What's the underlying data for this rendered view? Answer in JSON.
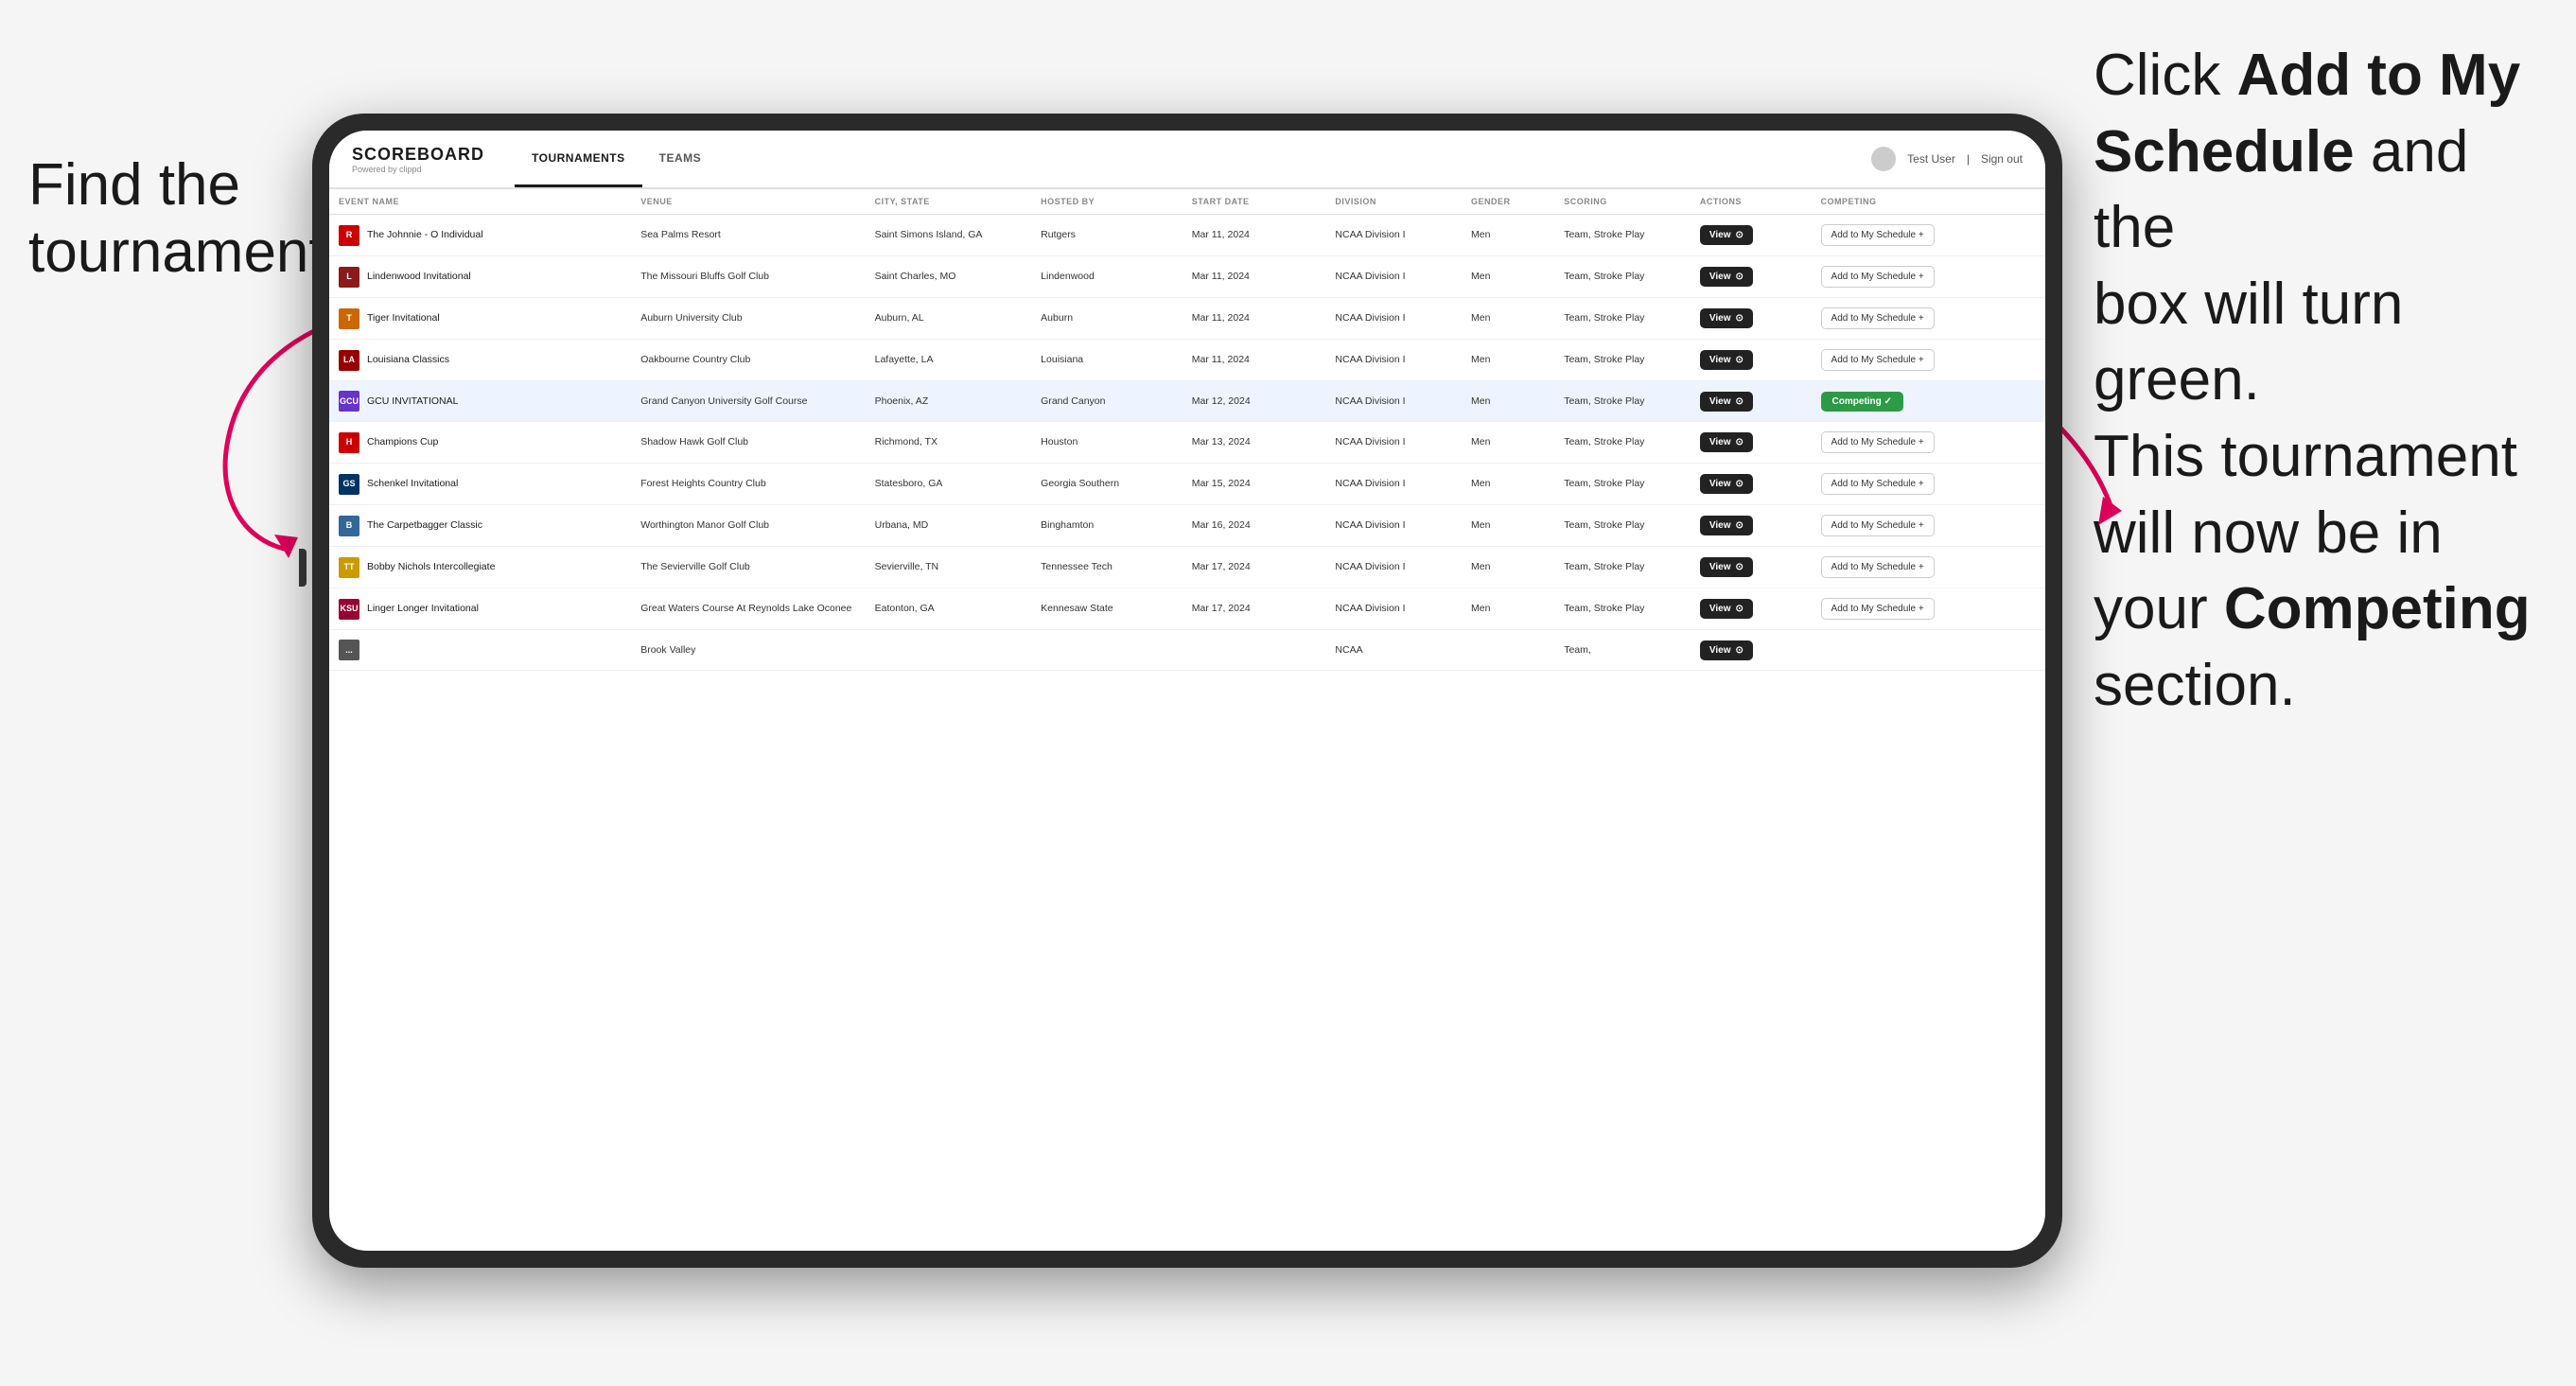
{
  "annotations": {
    "left": "Find the\ntournament.",
    "right_part1": "Click ",
    "right_bold1": "Add to My\nSchedule",
    "right_part2": " and the\nbox will turn green.\nThis tournament\nwill now be in\nyour ",
    "right_bold2": "Competing",
    "right_part3": "\nsection."
  },
  "nav": {
    "logo": "SCOREBOARD",
    "logo_sub": "Powered by clippd",
    "tabs": [
      "TOURNAMENTS",
      "TEAMS"
    ],
    "active_tab": "TOURNAMENTS",
    "user": "Test User",
    "signout": "Sign out"
  },
  "table": {
    "headers": [
      "EVENT NAME",
      "VENUE",
      "CITY, STATE",
      "HOSTED BY",
      "START DATE",
      "DIVISION",
      "GENDER",
      "SCORING",
      "ACTIONS",
      "COMPETING"
    ],
    "rows": [
      {
        "logo_color": "#cc0000",
        "logo_letter": "R",
        "event": "The Johnnie - O Individual",
        "venue": "Sea Palms Resort",
        "city": "Saint Simons Island, GA",
        "hosted": "Rutgers",
        "date": "Mar 11, 2024",
        "division": "NCAA Division I",
        "gender": "Men",
        "scoring": "Team, Stroke Play",
        "action": "View",
        "competing": "Add to My Schedule +",
        "is_competing": false,
        "highlighted": false
      },
      {
        "logo_color": "#8b1a1a",
        "logo_letter": "L",
        "event": "Lindenwood Invitational",
        "venue": "The Missouri Bluffs Golf Club",
        "city": "Saint Charles, MO",
        "hosted": "Lindenwood",
        "date": "Mar 11, 2024",
        "division": "NCAA Division I",
        "gender": "Men",
        "scoring": "Team, Stroke Play",
        "action": "View",
        "competing": "Add to My Schedule +",
        "is_competing": false,
        "highlighted": false
      },
      {
        "logo_color": "#cc6600",
        "logo_letter": "T",
        "event": "Tiger Invitational",
        "venue": "Auburn University Club",
        "city": "Auburn, AL",
        "hosted": "Auburn",
        "date": "Mar 11, 2024",
        "division": "NCAA Division I",
        "gender": "Men",
        "scoring": "Team, Stroke Play",
        "action": "View",
        "competing": "Add to My Schedule +",
        "is_competing": false,
        "highlighted": false
      },
      {
        "logo_color": "#990000",
        "logo_letter": "LA",
        "event": "Louisiana Classics",
        "venue": "Oakbourne Country Club",
        "city": "Lafayette, LA",
        "hosted": "Louisiana",
        "date": "Mar 11, 2024",
        "division": "NCAA Division I",
        "gender": "Men",
        "scoring": "Team, Stroke Play",
        "action": "View",
        "competing": "Add to My Schedule +",
        "is_competing": false,
        "highlighted": false
      },
      {
        "logo_color": "#6633cc",
        "logo_letter": "GCU",
        "event": "GCU INVITATIONAL",
        "venue": "Grand Canyon University Golf Course",
        "city": "Phoenix, AZ",
        "hosted": "Grand Canyon",
        "date": "Mar 12, 2024",
        "division": "NCAA Division I",
        "gender": "Men",
        "scoring": "Team, Stroke Play",
        "action": "View",
        "competing": "Competing ✓",
        "is_competing": true,
        "highlighted": true
      },
      {
        "logo_color": "#cc0000",
        "logo_letter": "H",
        "event": "Champions Cup",
        "venue": "Shadow Hawk Golf Club",
        "city": "Richmond, TX",
        "hosted": "Houston",
        "date": "Mar 13, 2024",
        "division": "NCAA Division I",
        "gender": "Men",
        "scoring": "Team, Stroke Play",
        "action": "View",
        "competing": "Add to My Schedule +",
        "is_competing": false,
        "highlighted": false
      },
      {
        "logo_color": "#003366",
        "logo_letter": "GS",
        "event": "Schenkel Invitational",
        "venue": "Forest Heights Country Club",
        "city": "Statesboro, GA",
        "hosted": "Georgia Southern",
        "date": "Mar 15, 2024",
        "division": "NCAA Division I",
        "gender": "Men",
        "scoring": "Team, Stroke Play",
        "action": "View",
        "competing": "Add to My Schedule +",
        "is_competing": false,
        "highlighted": false
      },
      {
        "logo_color": "#336699",
        "logo_letter": "B",
        "event": "The Carpetbagger Classic",
        "venue": "Worthington Manor Golf Club",
        "city": "Urbana, MD",
        "hosted": "Binghamton",
        "date": "Mar 16, 2024",
        "division": "NCAA Division I",
        "gender": "Men",
        "scoring": "Team, Stroke Play",
        "action": "View",
        "competing": "Add to My Schedule +",
        "is_competing": false,
        "highlighted": false
      },
      {
        "logo_color": "#cc9900",
        "logo_letter": "TT",
        "event": "Bobby Nichols Intercollegiate",
        "venue": "The Sevierville Golf Club",
        "city": "Sevierville, TN",
        "hosted": "Tennessee Tech",
        "date": "Mar 17, 2024",
        "division": "NCAA Division I",
        "gender": "Men",
        "scoring": "Team, Stroke Play",
        "action": "View",
        "competing": "Add to My Schedule +",
        "is_competing": false,
        "highlighted": false
      },
      {
        "logo_color": "#990033",
        "logo_letter": "KSU",
        "event": "Linger Longer Invitational",
        "venue": "Great Waters Course At Reynolds Lake Oconee",
        "city": "Eatonton, GA",
        "hosted": "Kennesaw State",
        "date": "Mar 17, 2024",
        "division": "NCAA Division I",
        "gender": "Men",
        "scoring": "Team, Stroke Play",
        "action": "View",
        "competing": "Add to My Schedule +",
        "is_competing": false,
        "highlighted": false
      },
      {
        "logo_color": "#555555",
        "logo_letter": "...",
        "event": "",
        "venue": "Brook Valley",
        "city": "",
        "hosted": "",
        "date": "",
        "division": "NCAA",
        "gender": "",
        "scoring": "Team,",
        "action": "View",
        "competing": "",
        "is_competing": false,
        "highlighted": false
      }
    ]
  }
}
